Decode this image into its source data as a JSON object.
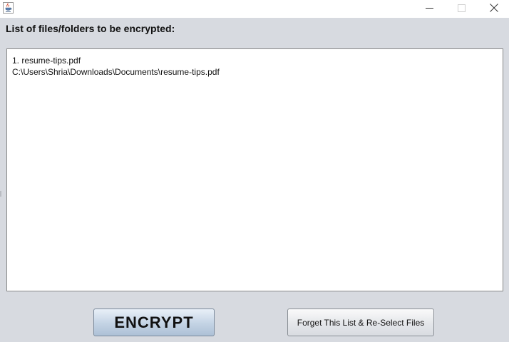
{
  "window": {
    "app_icon": "java-cup-icon",
    "controls": {
      "minimize_icon": "minimize-icon",
      "maximize_icon": "maximize-icon",
      "close_icon": "close-icon"
    }
  },
  "heading": "List of files/folders to be encrypted:",
  "file_list": {
    "lines": [
      "1. resume-tips.pdf",
      "C:\\Users\\Shria\\Downloads\\Documents\\resume-tips.pdf"
    ]
  },
  "buttons": {
    "encrypt_label": "ENCRYPT",
    "reselect_label": "Forget This List & Re-Select Files"
  },
  "colors": {
    "window_bg": "#d7dae0",
    "titlebar_bg": "#ffffff",
    "encrypt_btn_top": "#e9f0f8",
    "encrypt_btn_bottom": "#adc0d6"
  }
}
